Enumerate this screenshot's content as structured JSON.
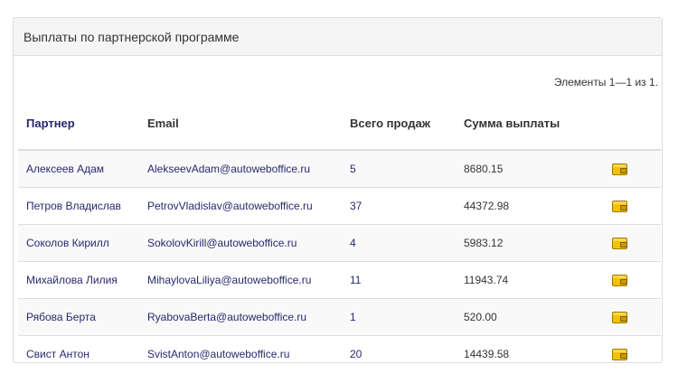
{
  "panel": {
    "title": "Выплаты по партнерской программе"
  },
  "summary": "Элементы 1—1 из 1.",
  "table": {
    "headers": {
      "partner": "Партнер",
      "email": "Email",
      "sales": "Всего продаж",
      "amount": "Сумма выплаты"
    },
    "rows": [
      {
        "partner": "Алексеев Адам",
        "email": "AlekseevAdam@autoweboffice.ru",
        "sales": "5",
        "amount": "8680.15",
        "icon": "wallet-icon"
      },
      {
        "partner": "Петров Владислав",
        "email": "PetrovVladislav@autoweboffice.ru",
        "sales": "37",
        "amount": "44372.98",
        "icon": "wallet-icon"
      },
      {
        "partner": "Соколов Кирилл",
        "email": "SokolovKirill@autoweboffice.ru",
        "sales": "4",
        "amount": "5983.12",
        "icon": "wallet-icon"
      },
      {
        "partner": "Михайлова Лилия",
        "email": "MihaylovaLiliya@autoweboffice.ru",
        "sales": "11",
        "amount": "11943.74",
        "icon": "wallet-icon"
      },
      {
        "partner": "Рябова Берта",
        "email": "RyabovaBerta@autoweboffice.ru",
        "sales": "1",
        "amount": "520.00",
        "icon": "wallet-icon"
      },
      {
        "partner": "Свист Антон",
        "email": "SvistAnton@autoweboffice.ru",
        "sales": "20",
        "amount": "14439.58",
        "icon": "wallet-icon"
      }
    ]
  },
  "colors": {
    "link": "#28286e",
    "header_link": "#26266e",
    "wallet": "#f2c200",
    "stripe": "#f9f9f9"
  }
}
